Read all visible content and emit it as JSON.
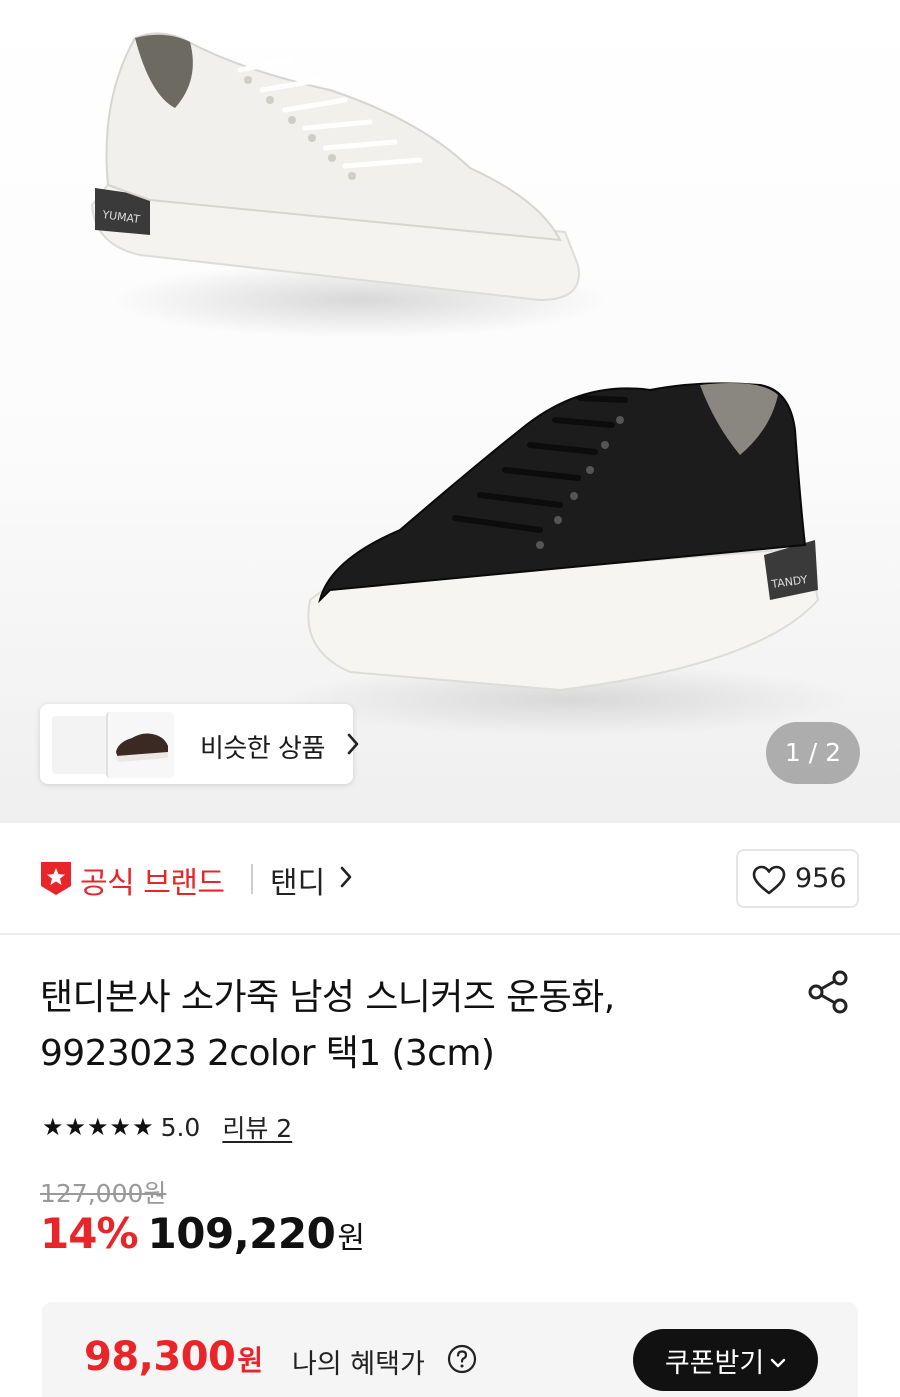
{
  "gallery": {
    "similar_products_label": "비슷한 상품",
    "page_indicator": "1 / 2"
  },
  "brand": {
    "official_label": "공식 브랜드",
    "name": "탠디",
    "like_count": "956"
  },
  "product": {
    "title": "탠디본사 소가죽 남성 스니커즈 운동화, 9923023 2color 택1 (3cm)",
    "rating": "5.0",
    "stars": "★★★★★",
    "review_link": "리뷰 2",
    "original_price": "127,000원",
    "discount_rate": "14%",
    "sale_price": "109,220",
    "sale_price_unit": "원"
  },
  "benefit": {
    "price": "98,300",
    "price_unit": "원",
    "label": "나의 혜택가",
    "coupon_button": "쿠폰받기"
  },
  "colors": {
    "accent_red": "#e8262a",
    "text_dark": "#111111"
  }
}
